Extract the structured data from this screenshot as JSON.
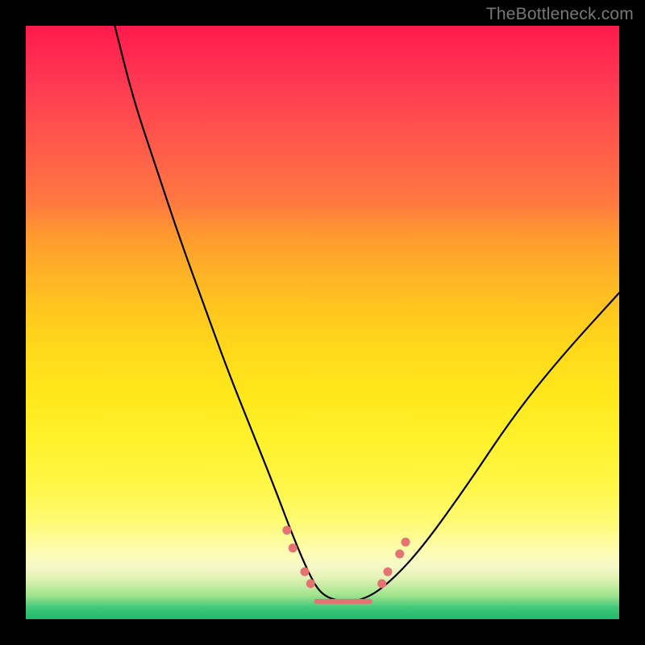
{
  "watermark": "TheBottleneck.com",
  "chart_data": {
    "type": "line",
    "title": "",
    "xlabel": "",
    "ylabel": "",
    "xlim": [
      0,
      100
    ],
    "ylim": [
      0,
      100
    ],
    "grid": false,
    "legend": false,
    "background_gradient": {
      "stops": [
        {
          "pos": 0.0,
          "color": "#ff1a4d"
        },
        {
          "pos": 0.35,
          "color": "#ff9830"
        },
        {
          "pos": 0.55,
          "color": "#ffda1a"
        },
        {
          "pos": 0.84,
          "color": "#fffb78"
        },
        {
          "pos": 0.93,
          "color": "#e3f3b6"
        },
        {
          "pos": 1.0,
          "color": "#1fb86e"
        }
      ]
    },
    "series": [
      {
        "name": "bottleneck-curve",
        "color": "#000000",
        "x": [
          15,
          18,
          22,
          26,
          30,
          34,
          38,
          42,
          45,
          48,
          50,
          53,
          56,
          60,
          66,
          74,
          82,
          90,
          100
        ],
        "y": [
          100,
          88,
          76,
          64,
          53,
          42,
          32,
          22,
          14,
          7,
          4,
          3,
          3,
          5,
          11,
          22,
          34,
          44,
          55
        ]
      }
    ],
    "markers": [
      {
        "name": "left-dot-1",
        "x": 44,
        "y": 15,
        "color": "#e57373"
      },
      {
        "name": "left-dot-2",
        "x": 45,
        "y": 12,
        "color": "#e57373"
      },
      {
        "name": "left-dot-3",
        "x": 47,
        "y": 8,
        "color": "#e57373"
      },
      {
        "name": "left-dot-4",
        "x": 48,
        "y": 6,
        "color": "#e57373"
      },
      {
        "name": "right-dot-1",
        "x": 60,
        "y": 6,
        "color": "#e57373"
      },
      {
        "name": "right-dot-2",
        "x": 61,
        "y": 8,
        "color": "#e57373"
      },
      {
        "name": "right-dot-3",
        "x": 63,
        "y": 11,
        "color": "#e57373"
      },
      {
        "name": "right-dot-4",
        "x": 64,
        "y": 13,
        "color": "#e57373"
      }
    ],
    "flat_segment": {
      "name": "valley-flat",
      "x_start": 49,
      "x_end": 58,
      "y": 3,
      "color": "#e57373",
      "stroke_width": 6
    }
  }
}
